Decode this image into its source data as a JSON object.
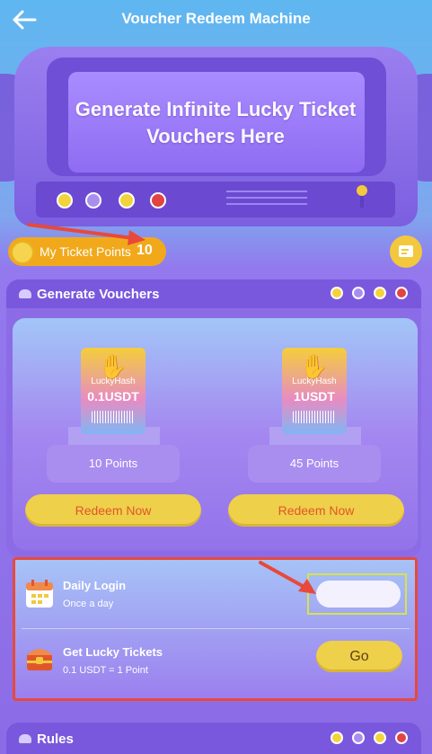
{
  "header": {
    "title": "Voucher Redeem Machine"
  },
  "machine": {
    "screen_text": "Generate Infinite Lucky Ticket Vouchers Here"
  },
  "points": {
    "label": "My Ticket Points",
    "value": "10"
  },
  "generate": {
    "title": "Generate Vouchers",
    "vouchers": [
      {
        "brand": "LuckyHash",
        "amount": "0.1USDT",
        "points": "10 Points",
        "button": "Redeem Now"
      },
      {
        "brand": "LuckyHash",
        "amount": "1USDT",
        "points": "45 Points",
        "button": "Redeem Now"
      }
    ]
  },
  "tasks": [
    {
      "title": "Daily Login",
      "subtitle": "Once a day",
      "button": ""
    },
    {
      "title": "Get Lucky Tickets",
      "subtitle": "0.1 USDT = 1 Point",
      "button": "Go"
    }
  ],
  "rules": {
    "title": "Rules"
  },
  "colors": {
    "accent_yellow": "#eed04a",
    "accent_orange": "#f1a91b",
    "redeem_text": "#e2552b",
    "annotation_red": "#e8493a",
    "purple_bg": "#8c6ce6"
  },
  "status_dots": [
    "#f3d33c",
    "#a98ef0",
    "#f3d33c",
    "#e24343"
  ]
}
